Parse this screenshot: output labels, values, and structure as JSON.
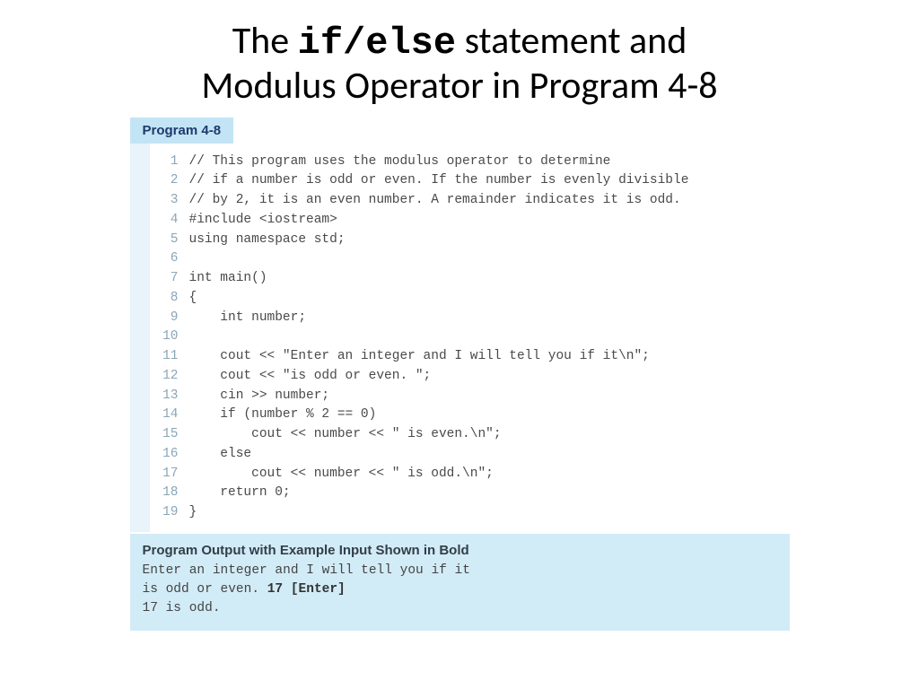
{
  "title": {
    "part1": "The ",
    "mono": "if/else",
    "part2": " statement and",
    "line2": "Modulus Operator in Program 4-8"
  },
  "program_tab": "Program 4-8",
  "code_lines": [
    "// This program uses the modulus operator to determine",
    "// if a number is odd or even. If the number is evenly divisible",
    "// by 2, it is an even number. A remainder indicates it is odd.",
    "#include <iostream>",
    "using namespace std;",
    "",
    "int main()",
    "{",
    "    int number;",
    "",
    "    cout << \"Enter an integer and I will tell you if it\\n\";",
    "    cout << \"is odd or even. \";",
    "    cin >> number;",
    "    if (number % 2 == 0)",
    "        cout << number << \" is even.\\n\";",
    "    else",
    "        cout << number << \" is odd.\\n\";",
    "    return 0;",
    "}"
  ],
  "output": {
    "heading": "Program Output with Example Input Shown in Bold",
    "line1": "Enter an integer and I will tell you if it",
    "line2a": "is odd or even. ",
    "line2b": "17 [Enter]",
    "line3": "17 is odd."
  }
}
